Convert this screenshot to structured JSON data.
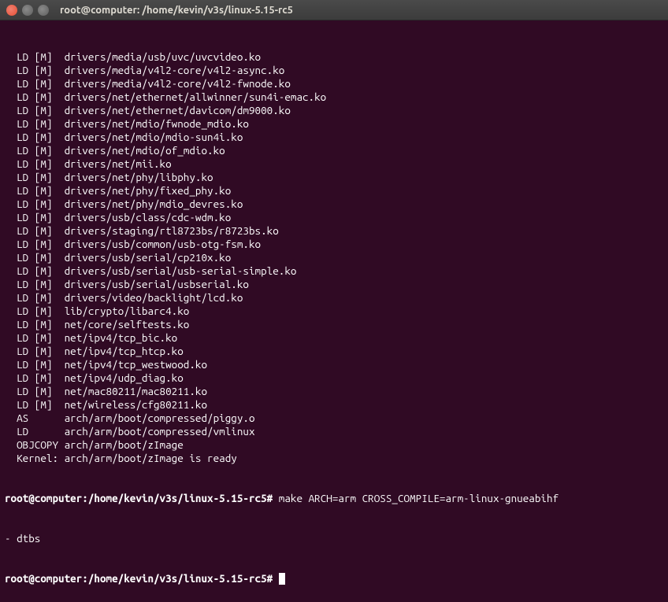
{
  "window": {
    "title": "root@computer: /home/kevin/v3s/linux-5.15-rc5"
  },
  "output_lines": [
    "  LD [M]  drivers/media/usb/uvc/uvcvideo.ko",
    "  LD [M]  drivers/media/v4l2-core/v4l2-async.ko",
    "  LD [M]  drivers/media/v4l2-core/v4l2-fwnode.ko",
    "  LD [M]  drivers/net/ethernet/allwinner/sun4i-emac.ko",
    "  LD [M]  drivers/net/ethernet/davicom/dm9000.ko",
    "  LD [M]  drivers/net/mdio/fwnode_mdio.ko",
    "  LD [M]  drivers/net/mdio/mdio-sun4i.ko",
    "  LD [M]  drivers/net/mdio/of_mdio.ko",
    "  LD [M]  drivers/net/mii.ko",
    "  LD [M]  drivers/net/phy/libphy.ko",
    "  LD [M]  drivers/net/phy/fixed_phy.ko",
    "  LD [M]  drivers/net/phy/mdio_devres.ko",
    "  LD [M]  drivers/usb/class/cdc-wdm.ko",
    "  LD [M]  drivers/staging/rtl8723bs/r8723bs.ko",
    "  LD [M]  drivers/usb/common/usb-otg-fsm.ko",
    "  LD [M]  drivers/usb/serial/cp210x.ko",
    "  LD [M]  drivers/usb/serial/usb-serial-simple.ko",
    "  LD [M]  drivers/usb/serial/usbserial.ko",
    "  LD [M]  drivers/video/backlight/lcd.ko",
    "  LD [M]  lib/crypto/libarc4.ko",
    "  LD [M]  net/core/selftests.ko",
    "  LD [M]  net/ipv4/tcp_bic.ko",
    "  LD [M]  net/ipv4/tcp_htcp.ko",
    "  LD [M]  net/ipv4/tcp_westwood.ko",
    "  LD [M]  net/ipv4/udp_diag.ko",
    "  LD [M]  net/mac80211/mac80211.ko",
    "  LD [M]  net/wireless/cfg80211.ko",
    "  AS      arch/arm/boot/compressed/piggy.o",
    "  LD      arch/arm/boot/compressed/vmlinux",
    "  OBJCOPY arch/arm/boot/zImage",
    "  Kernel: arch/arm/boot/zImage is ready"
  ],
  "prompt1": {
    "userhost": "root@computer",
    "path": ":/home/kevin/v3s/linux-5.15-rc5",
    "hash": "#",
    "command": " make ARCH=arm CROSS_COMPILE=arm-linux-gnueabihf- dtbs"
  },
  "prompt2": {
    "userhost": "root@computer",
    "path": ":/home/kevin/v3s/linux-5.15-rc5",
    "hash": "#"
  }
}
